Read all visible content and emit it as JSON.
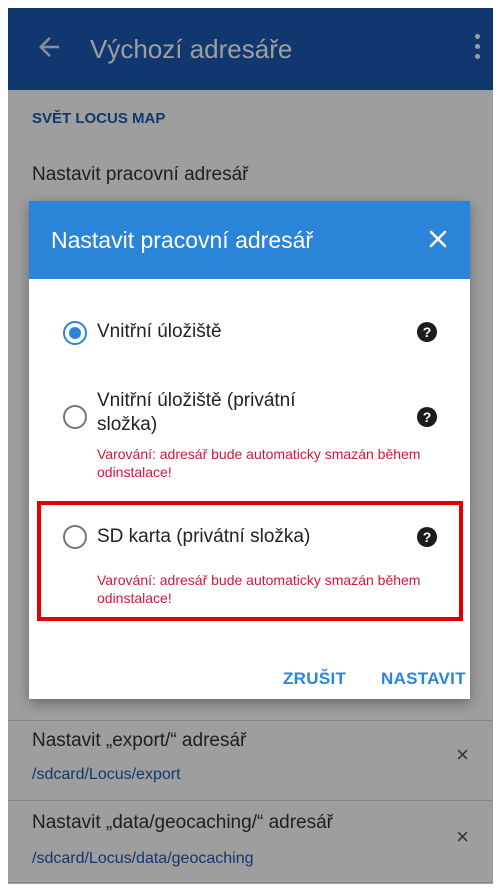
{
  "appbar": {
    "title": "Výchozí adresáře",
    "back_icon": "arrow-back-icon",
    "menu_icon": "more-vert-icon",
    "color": "#1a5ab3"
  },
  "background": {
    "section_header": "SVĚT LOCUS MAP",
    "working_dir_label": "Nastavit pracovní adresář",
    "export_label": "Nastavit „export/“ adresář",
    "export_path": "/sdcard/Locus/export",
    "geocaching_label": "Nastavit „data/geocaching/“ adresář",
    "geocaching_path": "/sdcard/Locus/data/geocaching",
    "remove_icon": "×"
  },
  "dialog": {
    "title": "Nastavit pracovní adresář",
    "close_icon": "close-icon",
    "header_color": "#2a85d8",
    "options": [
      {
        "label": "Vnitřní úložiště",
        "selected": true,
        "warning": ""
      },
      {
        "label": "Vnitřní úložiště (privátní složka)",
        "selected": false,
        "warning": "Varování: adresář bude automaticky smazán během odinstalace!"
      },
      {
        "label": "SD karta (privátní složka)",
        "selected": false,
        "warning": "Varování: adresář bude automaticky smazán během odinstalace!"
      }
    ],
    "help_glyph": "?",
    "cancel_label": "ZRUŠIT",
    "confirm_label": "NASTAVIT",
    "warning_color": "#d4163c",
    "highlight_color": "#e00000"
  }
}
